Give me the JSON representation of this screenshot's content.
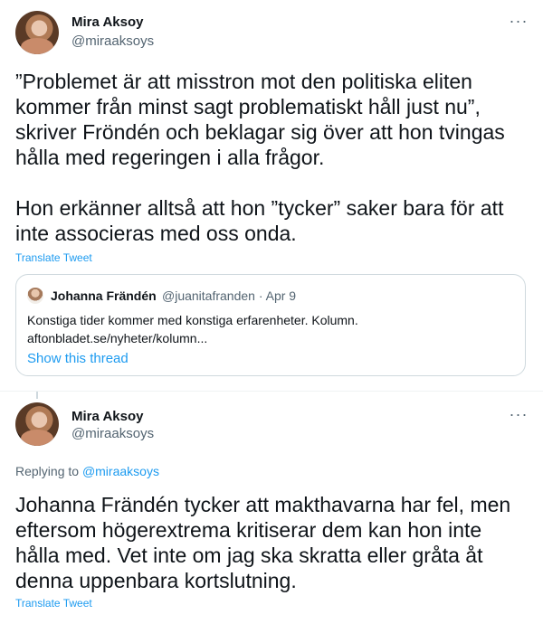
{
  "tweet1": {
    "name": "Mira Aksoy",
    "handle": "@miraaksoys",
    "more": "···",
    "text": "”Problemet är att misstron mot den politiska eliten\nkommer från minst sagt problematiskt håll just nu”,\nskriver Fröndén och beklagar sig över att hon tvingas\nhålla med regeringen i alla frågor.\n\nHon erkänner alltså att hon ”tycker” saker bara för att\ninte associeras med oss onda.",
    "translate": "Translate Tweet",
    "quote": {
      "name": "Johanna Frändén",
      "handle_date": "@juanitafranden · Apr 9",
      "body_line1": "Konstiga tider kommer med konstiga erfarenheter. Kolumn.",
      "body_line2": "aftonbladet.se/nyheter/kolumn...",
      "show_thread": "Show this thread"
    }
  },
  "tweet2": {
    "name": "Mira Aksoy",
    "handle": "@miraaksoys",
    "more": "···",
    "replying_prefix": "Replying to ",
    "replying_handle": "@miraaksoys",
    "text": "Johanna Frändén tycker att makthavarna har fel, men\neftersom högerextrema kritiserar dem kan hon inte\nhålla med. Vet inte om jag ska skratta eller gråta åt\ndenna uppenbara kortslutning.",
    "translate": "Translate Tweet"
  },
  "colors": {
    "accent": "#1d9bf0",
    "secondary_text": "#536471",
    "border": "#cfd9de"
  }
}
